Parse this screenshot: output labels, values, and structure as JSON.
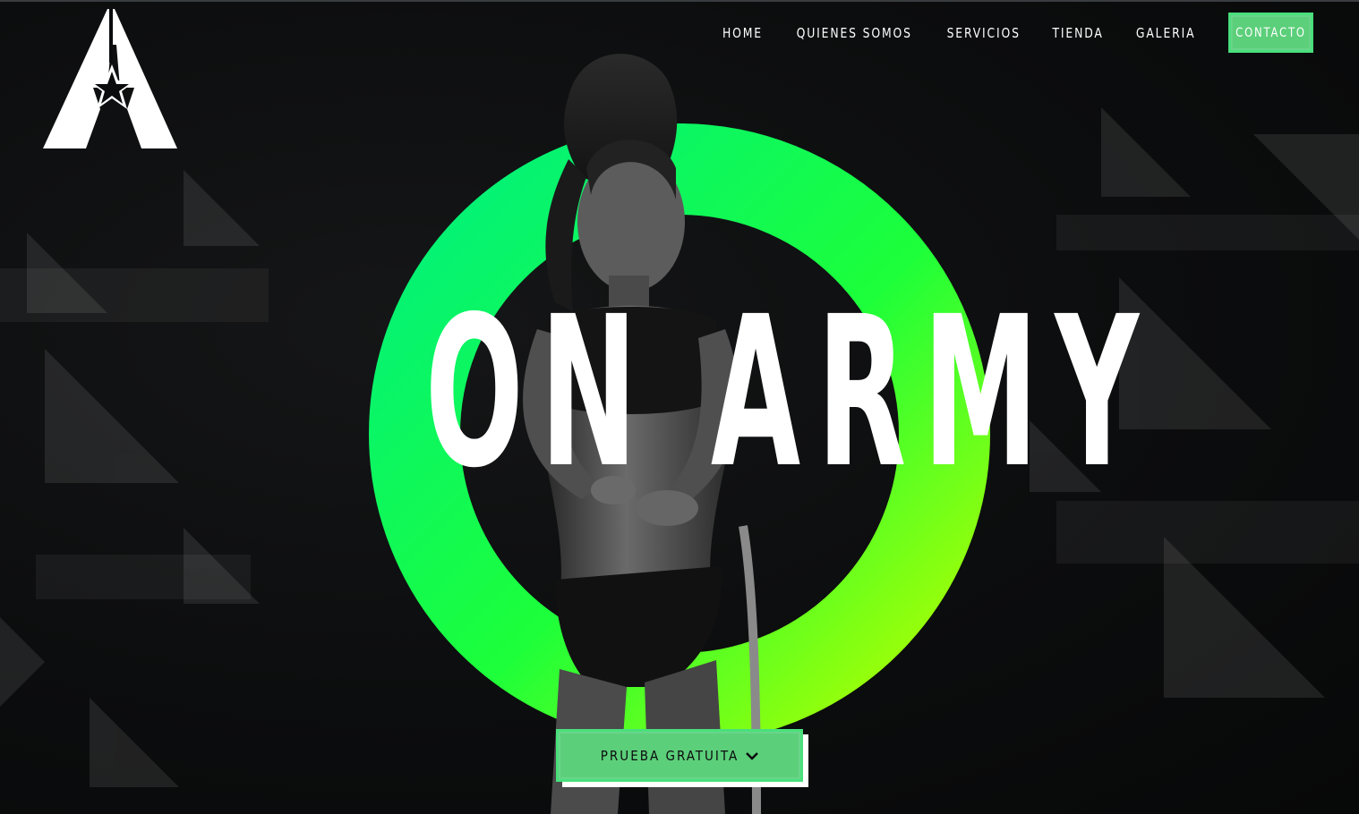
{
  "colors": {
    "background": "#0b0c0d",
    "accent_green": "#5ccf7a",
    "ring_gradient_start": "#00f77a",
    "ring_gradient_end": "#a8ff00",
    "text_white": "#ffffff"
  },
  "logo": {
    "icon": "star-a-logo-icon"
  },
  "nav": {
    "items": [
      {
        "label": "HOME"
      },
      {
        "label": "QUIENES SOMOS"
      },
      {
        "label": "SERVICIOS"
      },
      {
        "label": "TIENDA"
      },
      {
        "label": "GALERIA"
      }
    ],
    "cta_label": "CONTACTO"
  },
  "hero": {
    "headline": "ON ARMY",
    "cta_label": "PRUEBA GRATUITA",
    "cta_icon": "chevron-down-icon"
  }
}
